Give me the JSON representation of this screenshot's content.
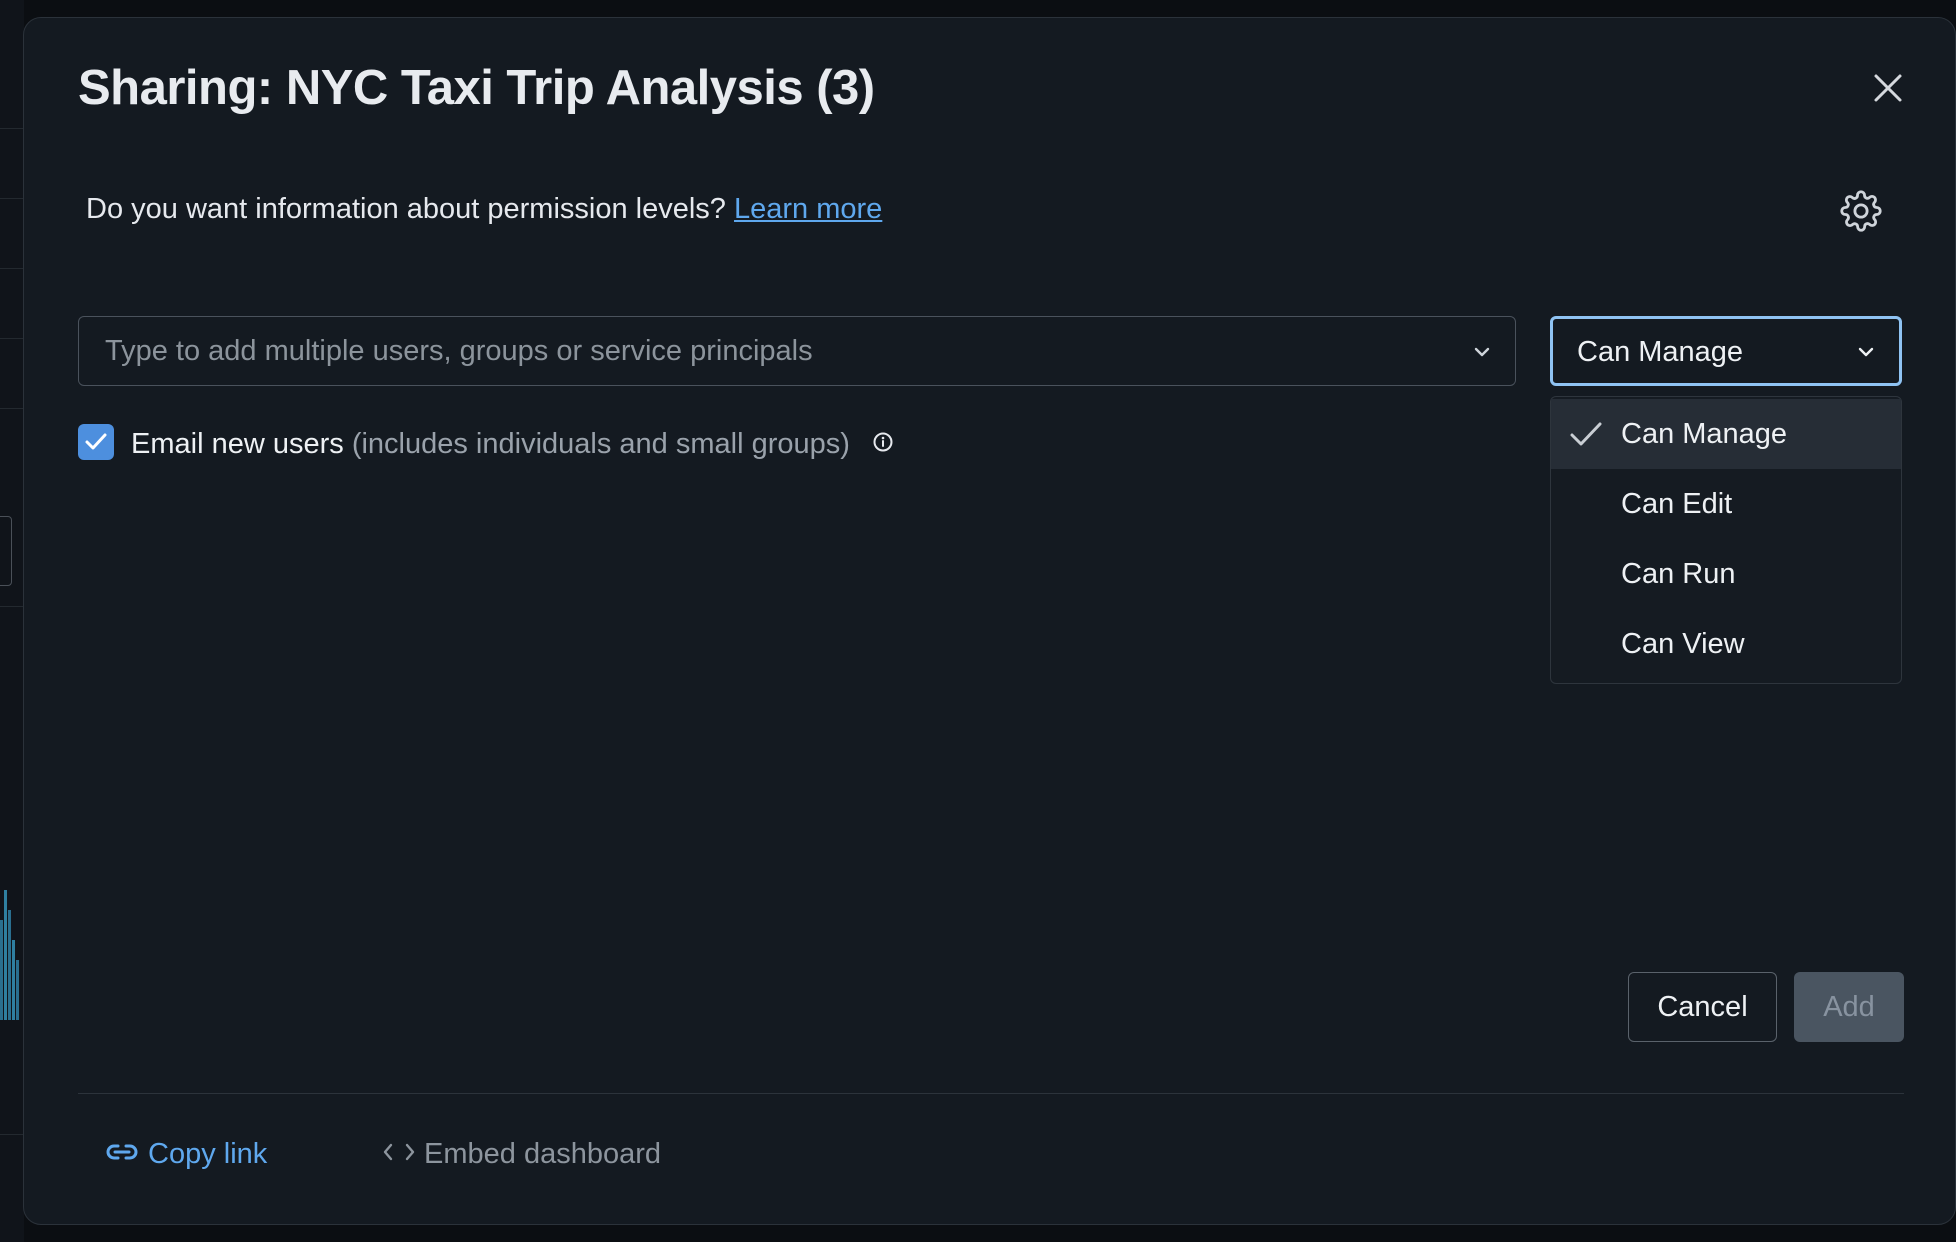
{
  "dialog": {
    "title": "Sharing: NYC Taxi Trip Analysis (3)",
    "info_text": "Do you want information about permission levels?",
    "learn_more": "Learn more"
  },
  "share_input": {
    "placeholder": "Type to add multiple users, groups or service principals",
    "value": ""
  },
  "permission": {
    "selected": "Can Manage",
    "options": [
      "Can Manage",
      "Can Edit",
      "Can Run",
      "Can View"
    ]
  },
  "email": {
    "checked": true,
    "label": "Email new users",
    "note": "(includes individuals and small groups)"
  },
  "buttons": {
    "cancel": "Cancel",
    "add": "Add"
  },
  "footer": {
    "copy_link": "Copy link",
    "embed": "Embed dashboard"
  },
  "colors": {
    "accent": "#4d8fde",
    "link": "#5fa8ee",
    "modal_bg": "#141a21"
  },
  "icons": [
    "close-icon",
    "gear-icon",
    "chevron-down-icon",
    "check-icon",
    "info-icon",
    "link-icon",
    "code-icon"
  ]
}
